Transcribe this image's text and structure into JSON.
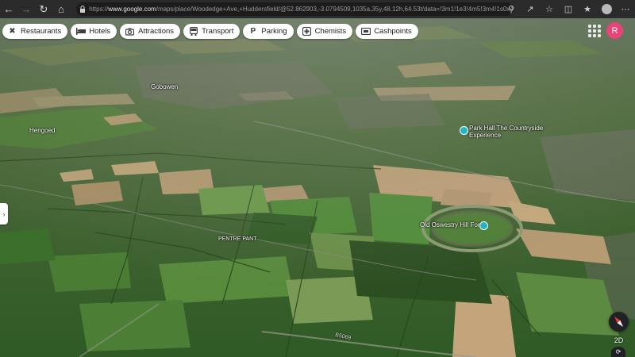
{
  "browser": {
    "url_prefix": "https://",
    "url_domain": "www.google.com",
    "url_path": "/maps/place/Woodedge+Ave,+Huddersfield/@52.862903,-3.0794509,1035a,35y,48.12h,64.53t/data=!3m1!1e3!4m5!3m4!1s0x487bdeafe2e69..."
  },
  "chips": [
    {
      "label": "Restaurants",
      "icon": "fork-knife-icon"
    },
    {
      "label": "Hotels",
      "icon": "bed-icon"
    },
    {
      "label": "Attractions",
      "icon": "camera-icon"
    },
    {
      "label": "Transport",
      "icon": "bus-icon"
    },
    {
      "label": "Parking",
      "icon": "parking-icon"
    },
    {
      "label": "Chemists",
      "icon": "pill-icon"
    },
    {
      "label": "Cashpoints",
      "icon": "cash-icon"
    }
  ],
  "account": {
    "initial": "R"
  },
  "map_labels": {
    "gobowen": "Gobowen",
    "hengoed": "Hengoed",
    "park_hall": "Park Hall The Countryside Experience",
    "old_oswestry": "Old Oswestry Hill Fort",
    "pentre_pant": "PENTRE PANT",
    "road": "B5069"
  },
  "controls": {
    "view_2d": "2D"
  },
  "colors": {
    "pin": "#1fb5c4",
    "account": "#e8447a"
  }
}
